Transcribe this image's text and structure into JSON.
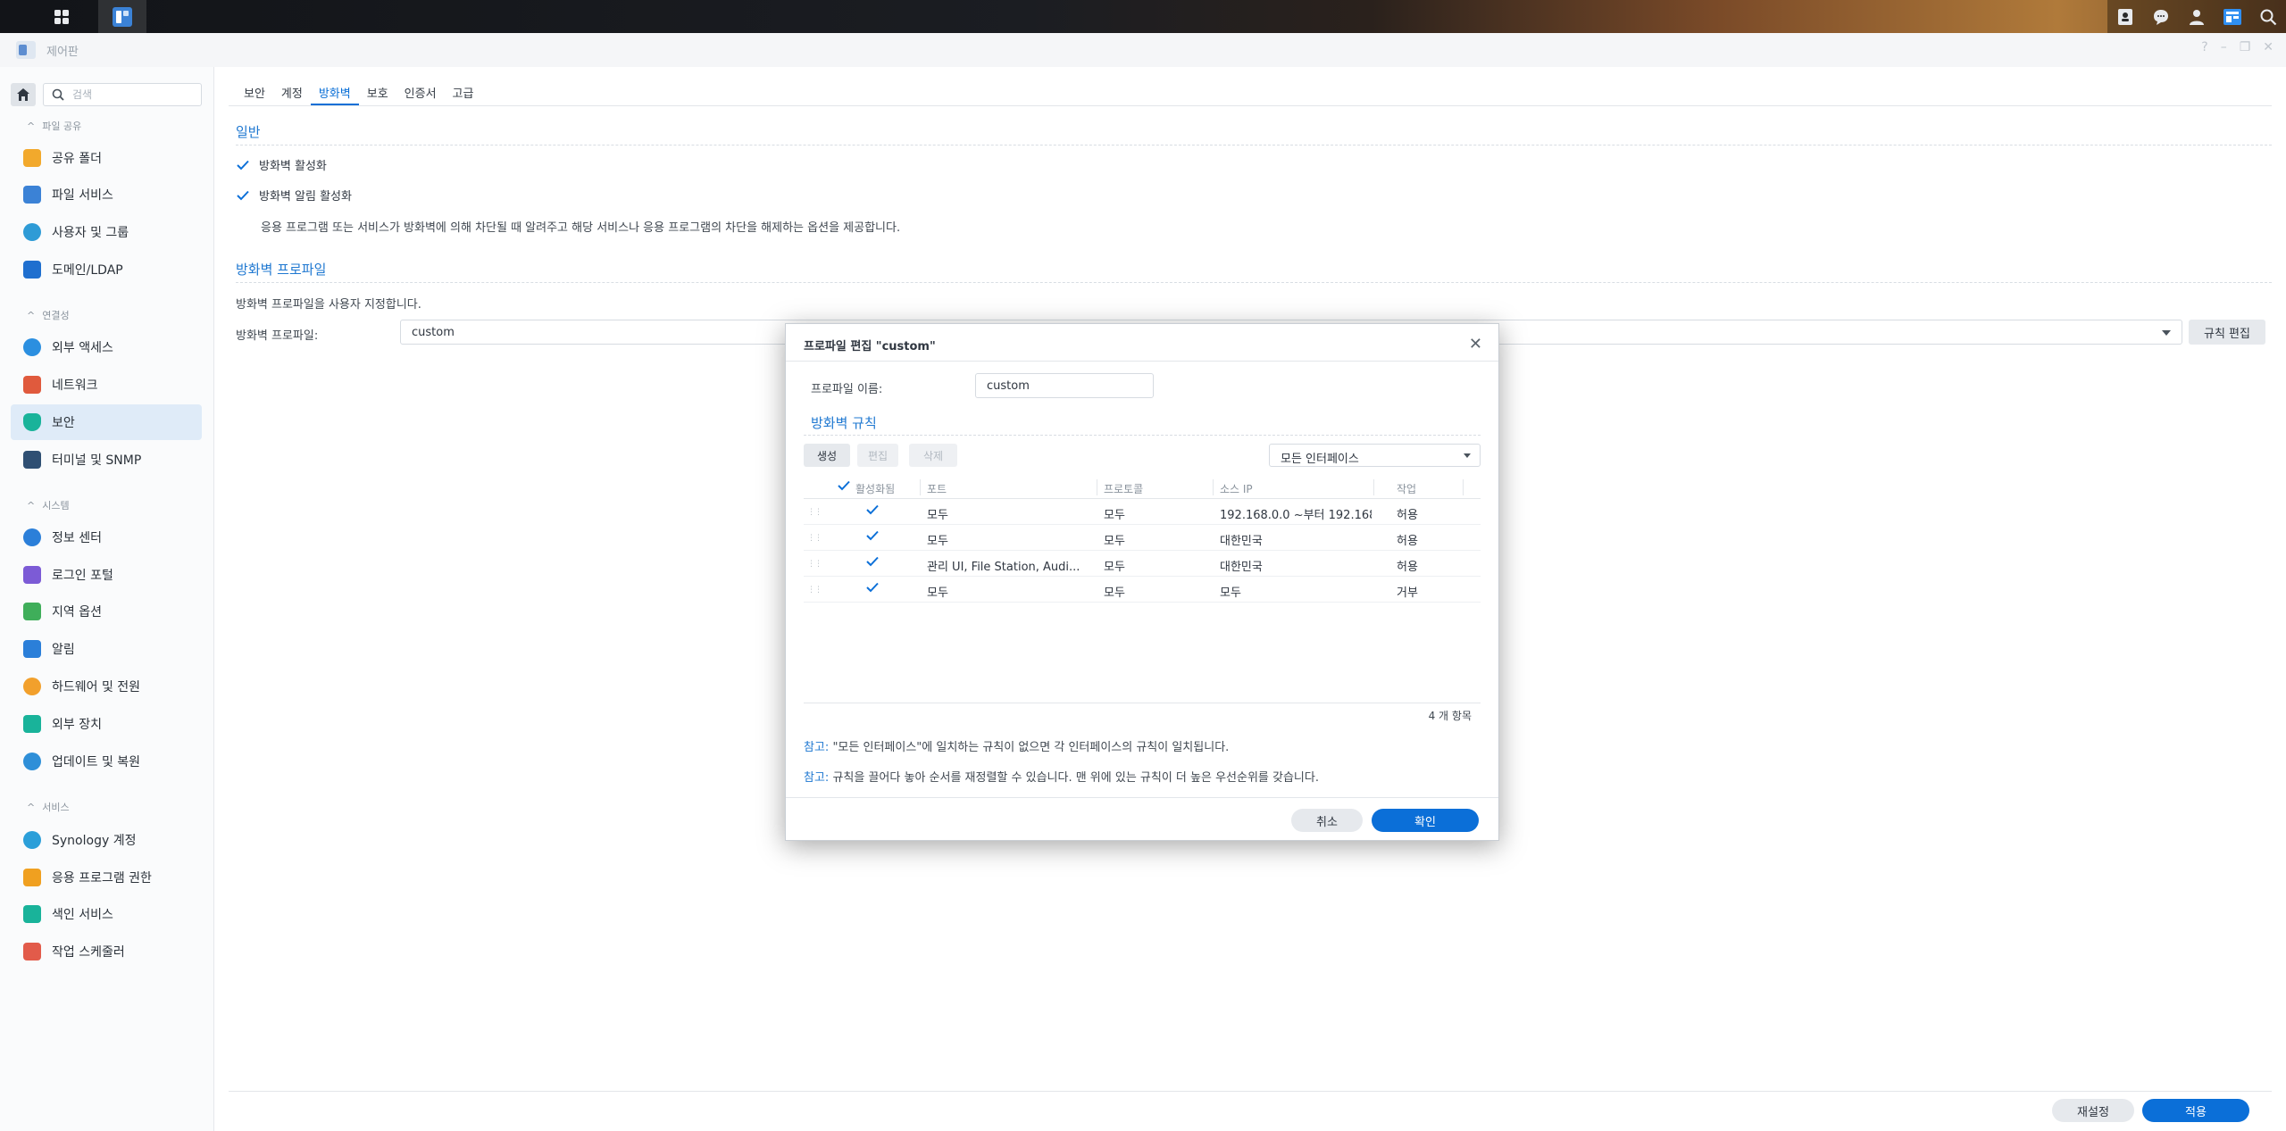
{
  "window": {
    "title": "제어판"
  },
  "taskbar": {
    "icons": [
      "apps-grid-icon",
      "control-panel-icon",
      "contact-icon",
      "chat-icon",
      "user-icon",
      "widgets-icon",
      "search-icon"
    ]
  },
  "sidebar": {
    "search_placeholder": "검색",
    "sections": {
      "file_sharing": "파일 공유",
      "connectivity": "연결성",
      "system": "시스템",
      "services": "서비스"
    },
    "items": [
      {
        "label": "공유 폴더",
        "icon": "shared-folder-icon"
      },
      {
        "label": "파일 서비스",
        "icon": "file-services-icon"
      },
      {
        "label": "사용자 및 그룹",
        "icon": "users-groups-icon"
      },
      {
        "label": "도메인/LDAP",
        "icon": "domain-ldap-icon"
      },
      {
        "label": "외부 액세스",
        "icon": "external-access-icon"
      },
      {
        "label": "네트워크",
        "icon": "network-icon"
      },
      {
        "label": "보안",
        "icon": "security-icon"
      },
      {
        "label": "터미널 및 SNMP",
        "icon": "terminal-icon"
      },
      {
        "label": "정보 센터",
        "icon": "info-center-icon"
      },
      {
        "label": "로그인 포털",
        "icon": "login-portal-icon"
      },
      {
        "label": "지역 옵션",
        "icon": "regional-options-icon"
      },
      {
        "label": "알림",
        "icon": "notification-icon"
      },
      {
        "label": "하드웨어 및 전원",
        "icon": "hardware-power-icon"
      },
      {
        "label": "외부 장치",
        "icon": "external-devices-icon"
      },
      {
        "label": "업데이트 및 복원",
        "icon": "update-restore-icon"
      },
      {
        "label": "Synology 계정",
        "icon": "synology-account-icon"
      },
      {
        "label": "응용 프로그램 권한",
        "icon": "app-privileges-icon"
      },
      {
        "label": "색인 서비스",
        "icon": "indexing-service-icon"
      },
      {
        "label": "작업 스케줄러",
        "icon": "task-scheduler-icon"
      }
    ]
  },
  "tabs": [
    "보안",
    "계정",
    "방화벽",
    "보호",
    "인증서",
    "고급"
  ],
  "firewall": {
    "general_title": "일반",
    "enable_label": "방화벽 활성화",
    "notify_label": "방화벽 알림 활성화",
    "notify_desc": "응용 프로그램 또는 서비스가 방화벽에 의해 차단될 때 알려주고 해당 서비스나 응용 프로그램의 차단을 해제하는 옵션을 제공합니다.",
    "profile_title": "방화벽 프로파일",
    "profile_desc": "방화벽 프로파일을 사용자 지정합니다.",
    "profile_label": "방화벽 프로파일:",
    "profile_value": "custom",
    "edit_rules": "규칙 편집"
  },
  "footer": {
    "reset": "재설정",
    "apply": "적용"
  },
  "dialog": {
    "title": "프로파일 편집 \"custom\"",
    "name_label": "프로파일 이름:",
    "name_value": "custom",
    "rules_title": "방화벽 규칙",
    "create": "생성",
    "edit": "편집",
    "delete": "삭제",
    "interface": "모든 인터페이스",
    "table": {
      "headers": [
        "활성화됨",
        "포트",
        "프로토콜",
        "소스 IP",
        "작업"
      ],
      "rows": [
        {
          "port": "모두",
          "protocol": "모두",
          "source": "192.168.0.0 ~부터 192.168...",
          "action": "허용"
        },
        {
          "port": "모두",
          "protocol": "모두",
          "source": "대한민국",
          "action": "허용"
        },
        {
          "port": "관리 UI, File Station, Audi...",
          "protocol": "모두",
          "source": "대한민국",
          "action": "허용"
        },
        {
          "port": "모두",
          "protocol": "모두",
          "source": "모두",
          "action": "거부"
        }
      ]
    },
    "count": "4 개 항목",
    "note_key": "참고:",
    "note1": "\"모든 인터페이스\"에 일치하는 규칙이 없으면 각 인터페이스의 규칙이 일치됩니다.",
    "note2": "규칙을 끌어다 놓아 순서를 재정렬할 수 있습니다. 맨 위에 있는 규칙이 더 높은 우선순위를 갖습니다.",
    "cancel": "취소",
    "ok": "확인"
  },
  "colors": {
    "accent": "#0b6fd8",
    "section_title": "#1f78d1",
    "active_sidebar": "#dfebf8"
  }
}
